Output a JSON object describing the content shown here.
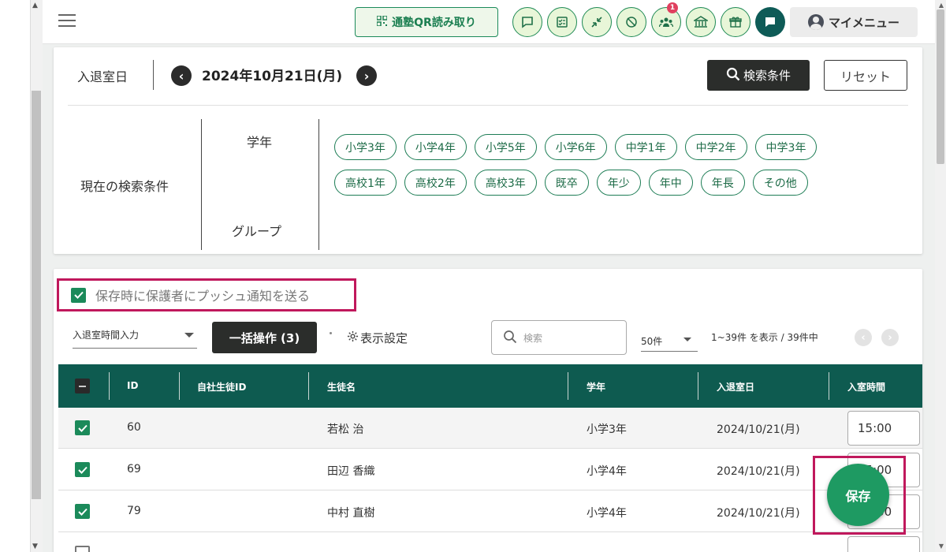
{
  "header": {
    "qr_button_label": "通塾QR読み取り",
    "notification_badge": "1",
    "my_menu_label": "マイメニュー"
  },
  "search_card": {
    "date_label": "入退室日",
    "date_value": "2024年10月21日(月)",
    "search_conditions_button": "検索条件",
    "reset_button": "リセット",
    "current_conditions_label": "現在の検索条件",
    "grade_label": "学年",
    "group_label": "グループ",
    "grade_chips": [
      "小学3年",
      "小学4年",
      "小学5年",
      "小学6年",
      "中学1年",
      "中学2年",
      "中学3年",
      "高校1年",
      "高校2年",
      "高校3年",
      "既卒",
      "年少",
      "年中",
      "年長",
      "その他"
    ]
  },
  "list_card": {
    "push_notification_label": "保存時に保護者にプッシュ通知を送る",
    "push_notification_checked": true,
    "mode_select_value": "入退室時間入力",
    "bulk_action_button": "一括操作 (3)",
    "display_settings_label": "表示設定",
    "search_placeholder": "検索",
    "per_page_value": "50件",
    "range_text": "1~39件 を表示 / 39件中"
  },
  "table": {
    "headers": {
      "id": "ID",
      "company_student_id": "自社生徒ID",
      "student_name": "生徒名",
      "grade": "学年",
      "entry_date": "入退室日",
      "entry_time": "入室時間"
    },
    "rows": [
      {
        "id": "60",
        "company_student_id": "",
        "student_name": "若松 治",
        "grade": "小学3年",
        "entry_date": "2024/10/21(月)",
        "entry_time": "15:00",
        "checked": true
      },
      {
        "id": "69",
        "company_student_id": "",
        "student_name": "田辺 香織",
        "grade": "小学4年",
        "entry_date": "2024/10/21(月)",
        "entry_time": "15:00",
        "checked": true
      },
      {
        "id": "79",
        "company_student_id": "",
        "student_name": "中村 直樹",
        "grade": "小学4年",
        "entry_date": "2024/10/21(月)",
        "entry_time": "15:00",
        "checked": true
      }
    ]
  },
  "save_button_label": "保存",
  "colors": {
    "brand_green": "#1b8a5a",
    "table_header": "#0e5b50",
    "highlight": "#c0185c",
    "dark_button": "#2b2d2b"
  }
}
